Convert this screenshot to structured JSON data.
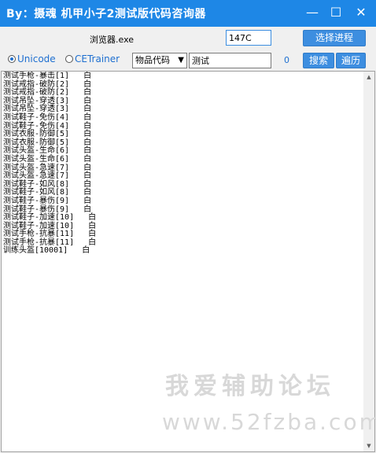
{
  "window": {
    "title": "By：摄魂 机甲小子2测试版代码咨询器",
    "minimize_glyph": "—",
    "maximize_glyph": "☐",
    "close_glyph": "✕"
  },
  "toolbar": {
    "process_label": "浏览器.exe",
    "process_input_value": "147C",
    "select_process_label": "选择进程",
    "radio_unicode_label": "Unicode",
    "radio_cetrainer_label": "CETrainer",
    "category_value": "物品代码",
    "search_value": "测试",
    "result_count": "0",
    "search_label": "搜索",
    "iterate_label": "遍历"
  },
  "list": {
    "rows": [
      "测试手枪-暴击[1]   白",
      "测试戒指-破防[2]   白",
      "测试戒指-破防[2]   白",
      "测试吊坠-穿透[3]   白",
      "测试吊坠-穿透[3]   白",
      "测试鞋子-免伤[4]   白",
      "测试鞋子-免伤[4]   白",
      "测试衣服-防御[5]   白",
      "测试衣服-防御[5]   白",
      "测试头盔-生命[6]   白",
      "测试头盔-生命[6]   白",
      "测试头盔-急速[7]   白",
      "测试头盔-急速[7]   白",
      "测试鞋子-如风[8]   白",
      "测试鞋子-如风[8]   白",
      "测试鞋子-暴伤[9]   白",
      "测试鞋子-暴伤[9]   白",
      "测试鞋子-加速[10]   白",
      "测试鞋子-加速[10]   白",
      "测试手枪-抗暴[11]   白",
      "测试手枪-抗暴[11]   白",
      "训练头盔[10001]   白"
    ]
  },
  "scrollbar": {
    "up_glyph": "▲",
    "down_glyph": "▼"
  },
  "watermark": {
    "line1": "我爱辅助论坛",
    "line2": "www.52fzba.com"
  }
}
